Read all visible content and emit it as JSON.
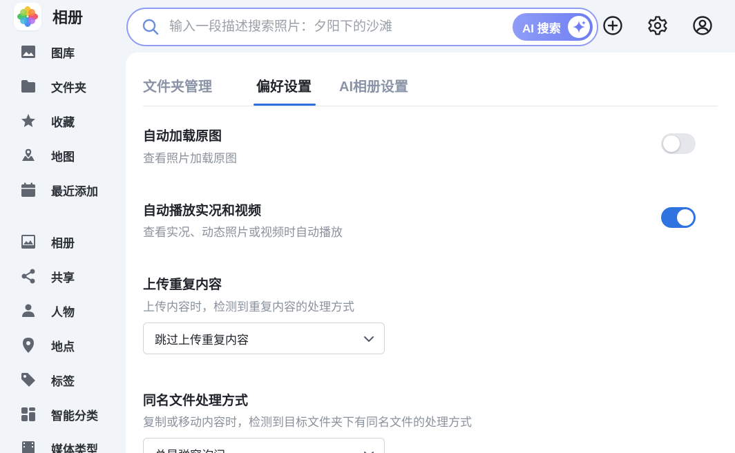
{
  "app": {
    "title": "相册"
  },
  "sidebar": {
    "items": [
      {
        "label": "图库",
        "icon": "image-icon"
      },
      {
        "label": "文件夹",
        "icon": "folder-icon"
      },
      {
        "label": "收藏",
        "icon": "star-icon"
      },
      {
        "label": "地图",
        "icon": "map-icon"
      },
      {
        "label": "最近添加",
        "icon": "calendar-icon"
      },
      {
        "label": "相册",
        "icon": "album-icon"
      },
      {
        "label": "共享",
        "icon": "share-icon"
      },
      {
        "label": "人物",
        "icon": "person-icon"
      },
      {
        "label": "地点",
        "icon": "location-pin-icon"
      },
      {
        "label": "标签",
        "icon": "tag-icon"
      },
      {
        "label": "智能分类",
        "icon": "grid-icon"
      },
      {
        "label": "媒体类型",
        "icon": "film-icon"
      }
    ]
  },
  "search": {
    "placeholder": "输入一段描述搜索照片：夕阳下的沙滩",
    "ai_button_label": "AI 搜索"
  },
  "tabs": [
    {
      "label": "文件夹管理",
      "active": false
    },
    {
      "label": "偏好设置",
      "active": true
    },
    {
      "label": "AI相册设置",
      "active": false
    }
  ],
  "settings": [
    {
      "title": "自动加载原图",
      "description": "查看照片加载原图",
      "type": "toggle",
      "enabled": false
    },
    {
      "title": "自动播放实况和视频",
      "description": "查看实况、动态照片或视频时自动播放",
      "type": "toggle",
      "enabled": true
    },
    {
      "title": "上传重复内容",
      "description": "上传内容时，检测到重复内容的处理方式",
      "type": "select",
      "value": "跳过上传重复内容"
    },
    {
      "title": "同名文件处理方式",
      "description": "复制或移动内容时，检测到目标文件夹下有同名文件的处理方式",
      "type": "select",
      "value": "总是弹窗询问"
    }
  ],
  "colors": {
    "accent": "#2f73e0",
    "sidebar_bg": "#f1f4f9",
    "search_border": "#8f9bf5",
    "icon_gray": "#5f6670"
  }
}
